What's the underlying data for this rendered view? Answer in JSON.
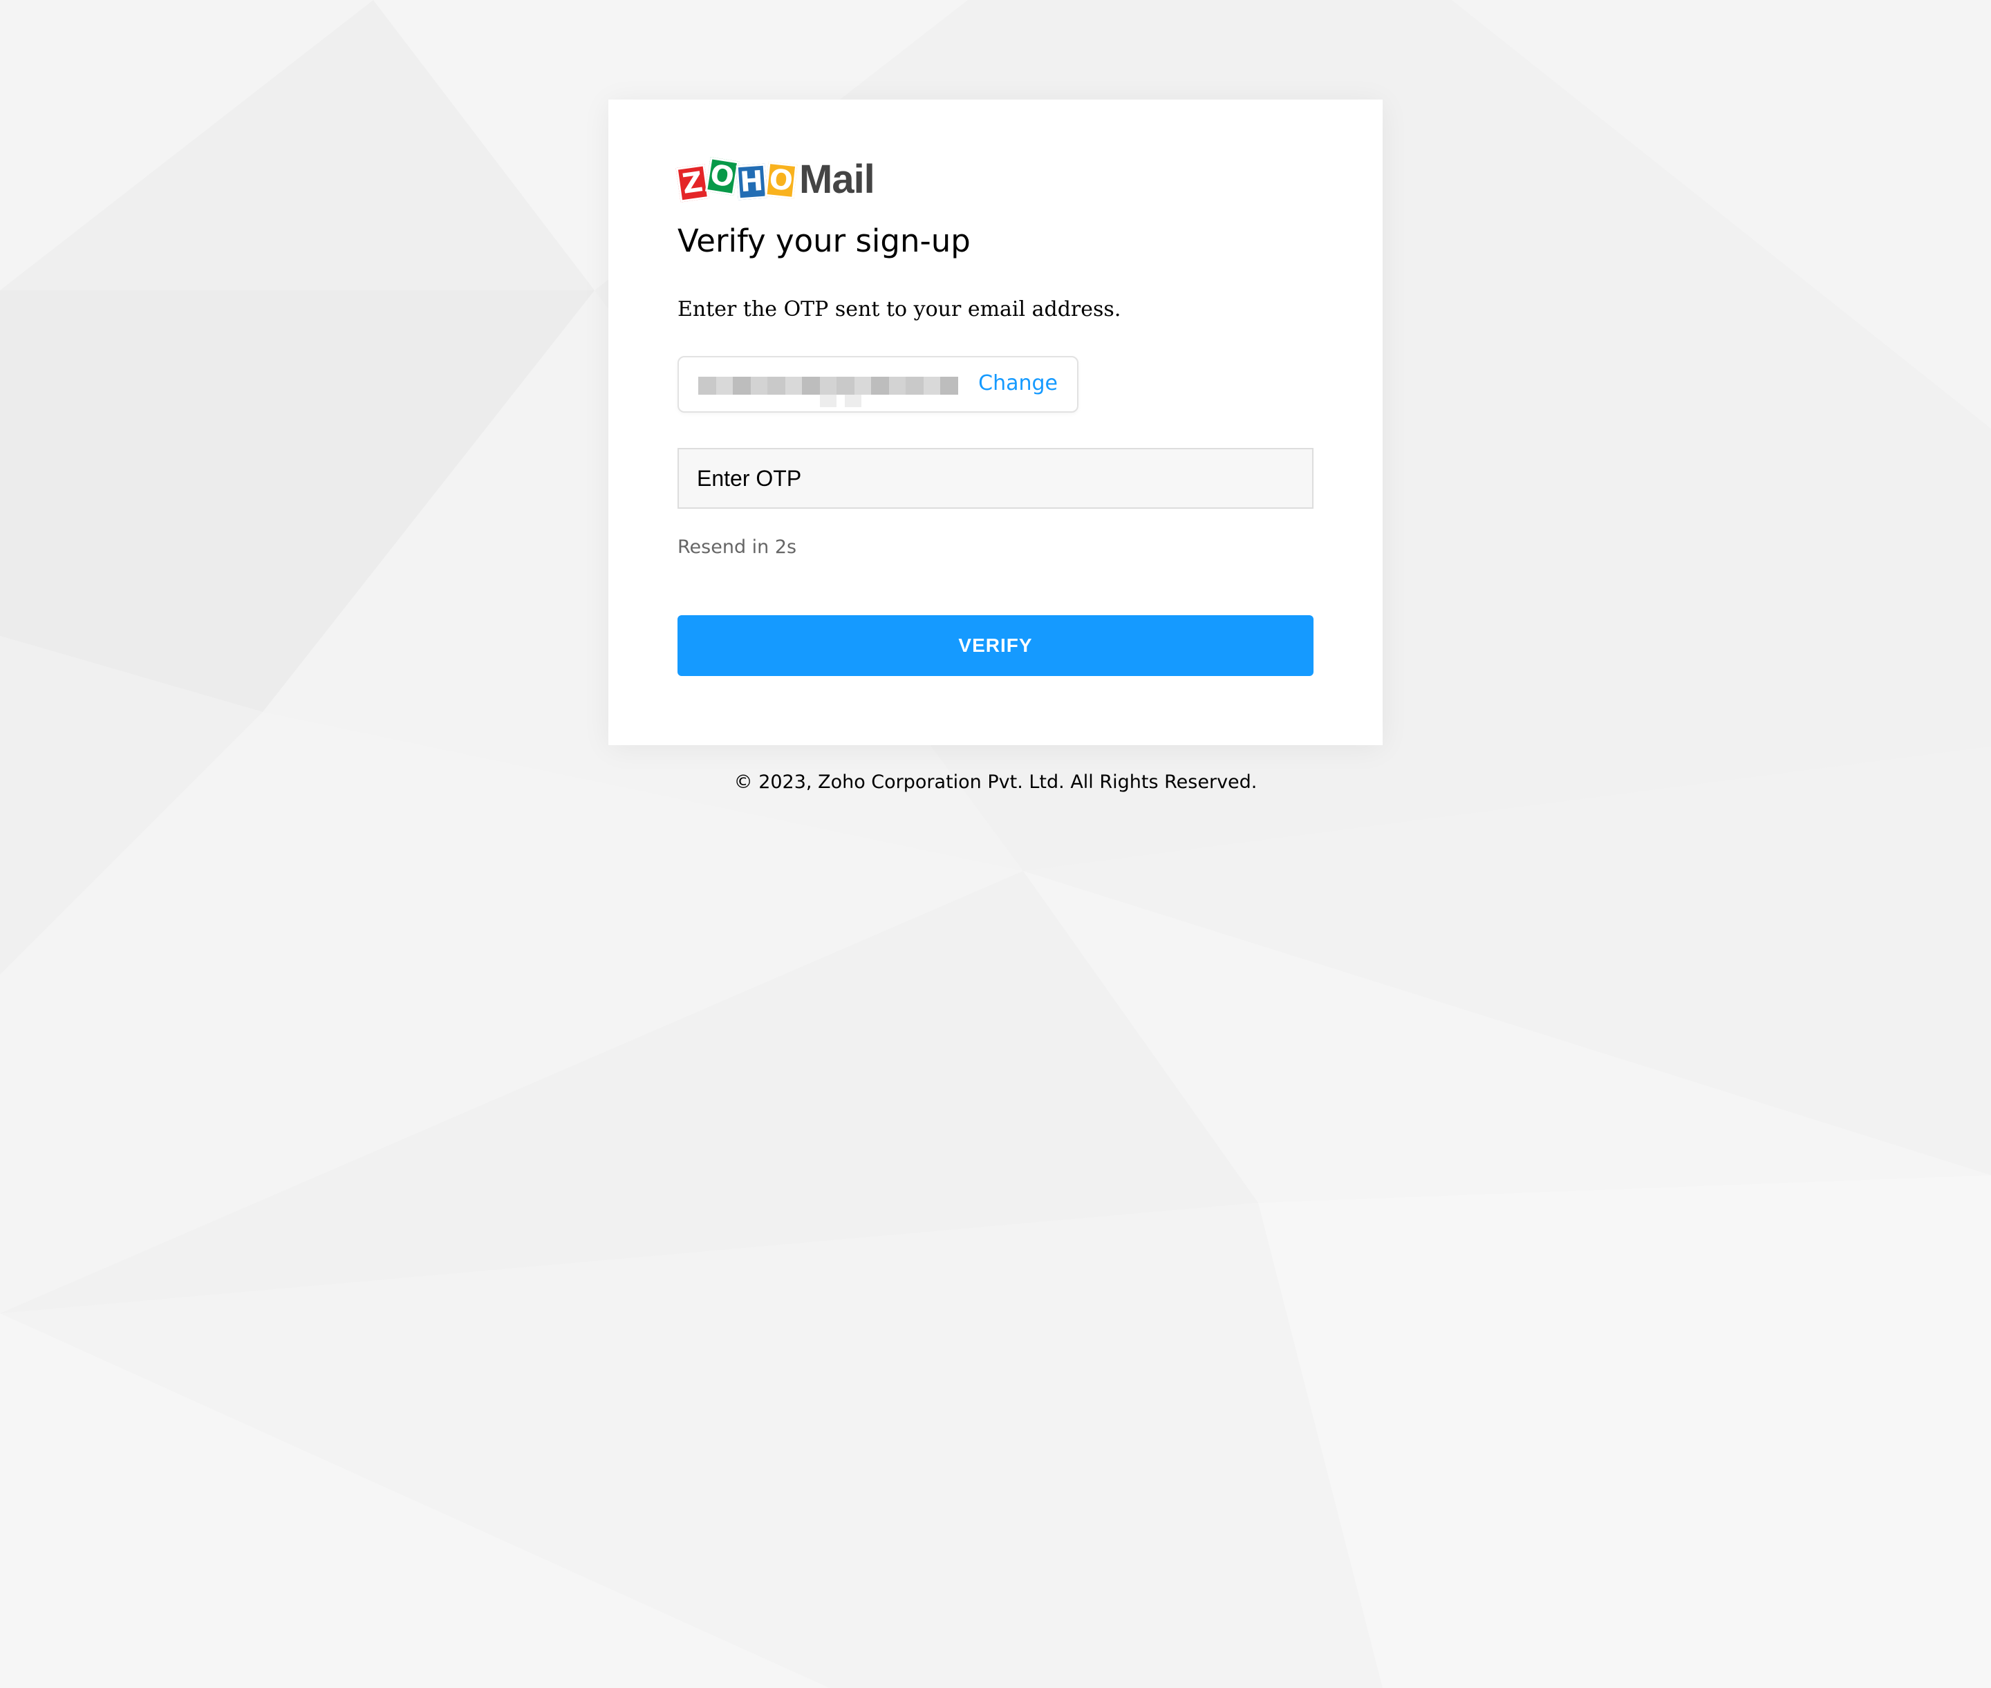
{
  "logo": {
    "tiles": [
      "Z",
      "O",
      "H",
      "O"
    ],
    "product": "Mail",
    "colors": [
      "#e42527",
      "#089949",
      "#226db4",
      "#f9b21d"
    ]
  },
  "page": {
    "title": "Verify your sign-up",
    "subtitle": "Enter the OTP sent to your email address."
  },
  "email_chip": {
    "change_label": "Change"
  },
  "otp": {
    "placeholder": "Enter OTP",
    "value": ""
  },
  "resend": {
    "text": "Resend in 2s"
  },
  "actions": {
    "verify_label": "VERIFY"
  },
  "footer": {
    "copyright": "© 2023, Zoho Corporation Pvt. Ltd. All Rights Reserved."
  },
  "colors": {
    "accent": "#159aff",
    "background": "#f3f3f3",
    "card": "#ffffff"
  }
}
